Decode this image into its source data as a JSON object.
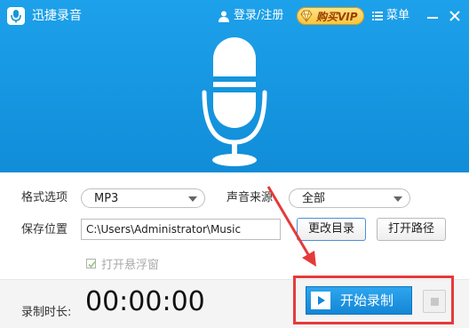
{
  "titlebar": {
    "title": "迅捷录音",
    "login_label": "登录/注册",
    "vip_label": "购买VIP",
    "menu_label": "菜单",
    "icons": [
      "app-mic-icon",
      "user-icon",
      "vip-diamond-icon",
      "menu-icon",
      "minimize-icon",
      "close-icon"
    ]
  },
  "settings": {
    "format_label": "格式选项",
    "format_value": "MP3",
    "source_label": "声音来源",
    "source_value": "全部",
    "save_label": "保存位置",
    "save_path": "C:\\Users\\Administrator\\Music",
    "change_dir_label": "更改目录",
    "open_path_label": "打开路径",
    "float_window_label": "打开悬浮窗",
    "float_window_checked": true
  },
  "footer": {
    "duration_label": "录制时长:",
    "duration_value": "00:00:00",
    "start_label": "开始录制"
  },
  "colors": {
    "header_blue": "#1596dd",
    "annotation_red": "#e53a3a",
    "button_blue": "#1a8fdc"
  }
}
